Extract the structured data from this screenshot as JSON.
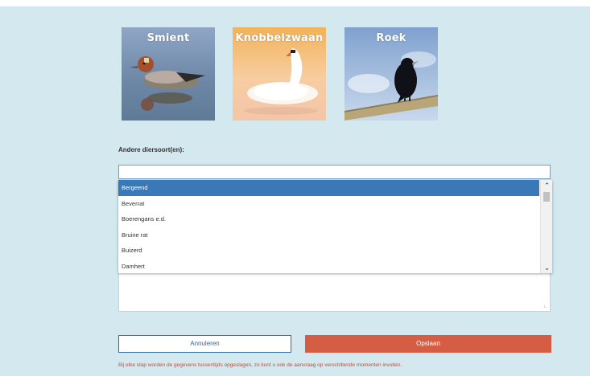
{
  "colors": {
    "panel_bg": "#d3e8ef",
    "accent_blue": "#3a78b8",
    "save_red": "#d55d44",
    "note_red": "#c24f3a"
  },
  "species_cards": [
    {
      "label": "Smient",
      "image": "wigeon-duck-photo"
    },
    {
      "label": "Knobbelzwaan",
      "image": "mute-swan-photo"
    },
    {
      "label": "Roek",
      "image": "rook-photo"
    }
  ],
  "other_species": {
    "label": "Andere diersoort(en):",
    "input_value": "",
    "dropdown_options": [
      "Bergeend",
      "Beverrat",
      "Boerengans e.d.",
      "Bruine rat",
      "Buizerd",
      "Damhert"
    ],
    "selected_index": 0
  },
  "buttons": {
    "cancel_label": "Annuleren",
    "save_label": "Opslaan"
  },
  "info_note": "Bij elke stap worden de gegevens tussentijds opgeslagen, zo kunt u ook de aanvraag op verschillende momenten invullen."
}
